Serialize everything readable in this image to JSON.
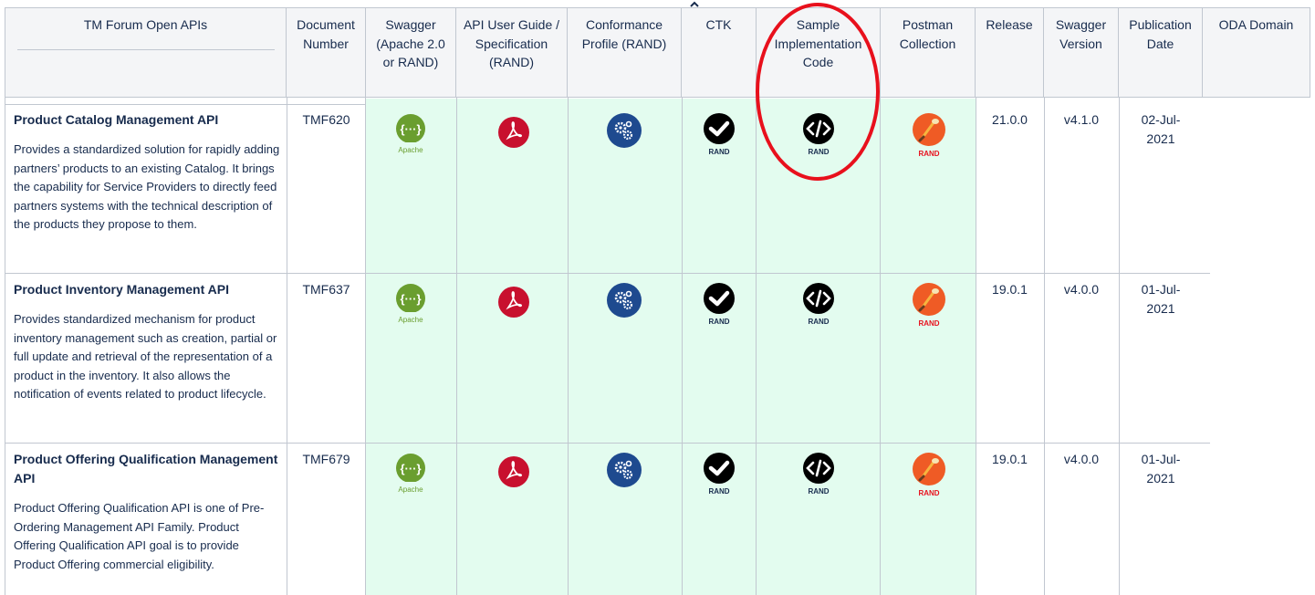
{
  "table": {
    "headers": [
      "TM Forum Open APIs",
      "Document Number",
      "Swagger (Apache 2.0 or RAND)",
      "API User Guide / Specification (RAND)",
      "Conformance Profile (RAND)",
      "CTK",
      "Sample Implementation Code",
      "Postman Collection",
      "Release",
      "Swagger Version",
      "Publication Date",
      "ODA Domain"
    ],
    "rows": [
      {
        "title": "Product Catalog Management API",
        "description": "Provides a standardized solution for rapidly adding partners’ products to an existing Catalog. It brings the capability for Service Providers to directly feed partners systems with the technical description of the products they propose to them.",
        "doc": "TMF620",
        "swagger_tag": "Apache",
        "ctk_tag": "RAND",
        "code_tag": "RAND",
        "postman_tag": "RAND",
        "release": "21.0.0",
        "swagger_version": "v4.1.0",
        "date": "02-Jul-2021"
      },
      {
        "title": "Product Inventory Management API",
        "description": "Provides standardized mechanism for product inventory management such as creation, partial or full update and retrieval of the representation of a product in the inventory. It also allows the notification of events related to product lifecycle.",
        "doc": "TMF637",
        "swagger_tag": "Apache",
        "ctk_tag": "RAND",
        "code_tag": "RAND",
        "postman_tag": "RAND",
        "release": "19.0.1",
        "swagger_version": "v4.0.0",
        "date": "01-Jul-2021"
      },
      {
        "title": "Product Offering Qualification Management API",
        "description": "Product Offering Qualification API is one of Pre-Ordering Management API Family. Product Offering Qualification API goal is to provide Product Offering commercial eligibility.",
        "doc": "TMF679",
        "swagger_tag": "Apache",
        "ctk_tag": "RAND",
        "code_tag": "RAND",
        "postman_tag": "RAND",
        "release": "19.0.1",
        "swagger_version": "v4.0.0",
        "date": "01-Jul-2021"
      }
    ]
  },
  "colors": {
    "highlight": "#e8101c",
    "green_cell": "#e3fcef",
    "swagger": "#6a9e2f",
    "pdf": "#c8102e",
    "conformance": "#1e4a8f",
    "postman": "#ef5b25"
  },
  "icons": {
    "swagger": "swagger-icon",
    "pdf": "pdf-icon",
    "conformance": "gears-icon",
    "ctk": "checkmark-icon",
    "code": "code-icon",
    "postman": "postman-icon",
    "collapse": "chevron-up-icon"
  }
}
